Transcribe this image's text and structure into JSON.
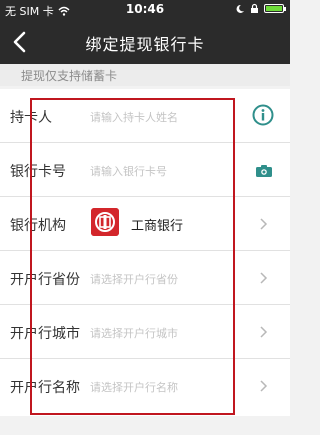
{
  "status_bar": {
    "carrier": "无 SIM 卡",
    "time": "10:46"
  },
  "nav": {
    "title": "绑定提现银行卡"
  },
  "hint": "提现仅支持储蓄卡",
  "form": {
    "holder": {
      "label": "持卡人",
      "placeholder": "请输入持卡人姓名"
    },
    "card_number": {
      "label": "银行卡号",
      "placeholder": "请输入银行卡号"
    },
    "institution": {
      "label": "银行机构",
      "value": "工商银行"
    },
    "province": {
      "label": "开户行省份",
      "placeholder": "请选择开户行省份"
    },
    "city": {
      "label": "开户行城市",
      "placeholder": "请选择开户行城市"
    },
    "branch": {
      "label": "开户行名称",
      "placeholder": "请选择开户行名称"
    }
  },
  "colors": {
    "accent": "#2f8f8b",
    "nav_bg": "#2b2b2b",
    "highlight": "#c0161f",
    "bank_red": "#d3262b"
  },
  "icons": [
    "back-icon",
    "wifi-icon",
    "battery-icon",
    "info-icon",
    "camera-icon",
    "chevron-right-icon",
    "icbc-logo"
  ]
}
